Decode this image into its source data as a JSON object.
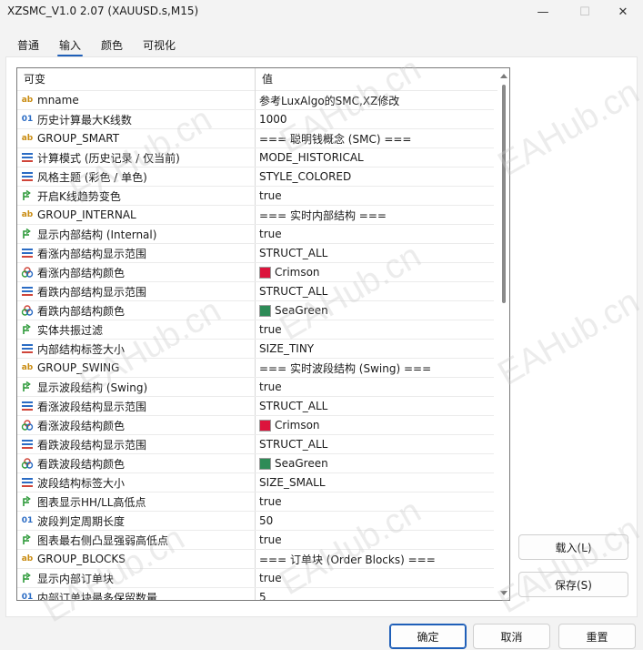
{
  "window": {
    "title": "XZSMC_V1.0 2.07 (XAUUSD.s,M15)",
    "min_glyph": "—",
    "max_glyph": "☐",
    "close_glyph": "✕"
  },
  "tabs": [
    {
      "label": "普通",
      "active": false
    },
    {
      "label": "输入",
      "active": true
    },
    {
      "label": "颜色",
      "active": false
    },
    {
      "label": "可视化",
      "active": false
    }
  ],
  "grid": {
    "columns": {
      "name": "可变",
      "value": "值"
    },
    "rows": [
      {
        "icon": "ab",
        "name": "mname",
        "value": "参考LuxAlgo的SMC,XZ修改"
      },
      {
        "icon": "01",
        "name": "历史计算最大K线数",
        "value": "1000"
      },
      {
        "icon": "ab",
        "name": "GROUP_SMART",
        "value": "=== 聪明钱概念 (SMC) ==="
      },
      {
        "icon": "enum",
        "name": "计算模式 (历史记录 / 仅当前)",
        "value": "MODE_HISTORICAL"
      },
      {
        "icon": "enum",
        "name": "风格主题 (彩色 / 单色)",
        "value": "STYLE_COLORED"
      },
      {
        "icon": "bool",
        "name": "开启K线趋势变色",
        "value": "true"
      },
      {
        "icon": "ab",
        "name": "GROUP_INTERNAL",
        "value": "=== 实时内部结构 ==="
      },
      {
        "icon": "bool",
        "name": "显示内部结构 (Internal)",
        "value": "true"
      },
      {
        "icon": "enum",
        "name": "看涨内部结构显示范围",
        "value": "STRUCT_ALL"
      },
      {
        "icon": "color",
        "name": "看涨内部结构颜色",
        "value": "Crimson",
        "swatch": "#dc143c"
      },
      {
        "icon": "enum",
        "name": "看跌内部结构显示范围",
        "value": "STRUCT_ALL"
      },
      {
        "icon": "color",
        "name": "看跌内部结构颜色",
        "value": "SeaGreen",
        "swatch": "#2e8b57"
      },
      {
        "icon": "bool",
        "name": "实体共振过滤",
        "value": "true"
      },
      {
        "icon": "enum",
        "name": "内部结构标签大小",
        "value": "SIZE_TINY"
      },
      {
        "icon": "ab",
        "name": "GROUP_SWING",
        "value": "=== 实时波段结构 (Swing) ==="
      },
      {
        "icon": "bool",
        "name": "显示波段结构 (Swing)",
        "value": "true"
      },
      {
        "icon": "enum",
        "name": "看涨波段结构显示范围",
        "value": "STRUCT_ALL"
      },
      {
        "icon": "color",
        "name": "看涨波段结构颜色",
        "value": "Crimson",
        "swatch": "#dc143c"
      },
      {
        "icon": "enum",
        "name": "看跌波段结构显示范围",
        "value": "STRUCT_ALL"
      },
      {
        "icon": "color",
        "name": "看跌波段结构颜色",
        "value": "SeaGreen",
        "swatch": "#2e8b57"
      },
      {
        "icon": "enum",
        "name": "波段结构标签大小",
        "value": "SIZE_SMALL"
      },
      {
        "icon": "bool",
        "name": "图表显示HH/LL高低点",
        "value": "true"
      },
      {
        "icon": "01",
        "name": "波段判定周期长度",
        "value": "50"
      },
      {
        "icon": "bool",
        "name": "图表最右侧凸显强弱高低点",
        "value": "true"
      },
      {
        "icon": "ab",
        "name": "GROUP_BLOCKS",
        "value": "=== 订单块 (Order Blocks) ==="
      },
      {
        "icon": "bool",
        "name": "显示内部订单块",
        "value": "true"
      },
      {
        "icon": "01",
        "name": "内部订单块最多保留数量",
        "value": "5"
      }
    ]
  },
  "buttons": {
    "load": "载入(L)",
    "save": "保存(S)",
    "ok": "确定",
    "cancel": "取消",
    "reset": "重置"
  },
  "watermark": "EAHub.cn",
  "colors": {
    "accent": "#1f5fb8",
    "crimson": "#dc143c",
    "seagreen": "#2e8b57"
  }
}
